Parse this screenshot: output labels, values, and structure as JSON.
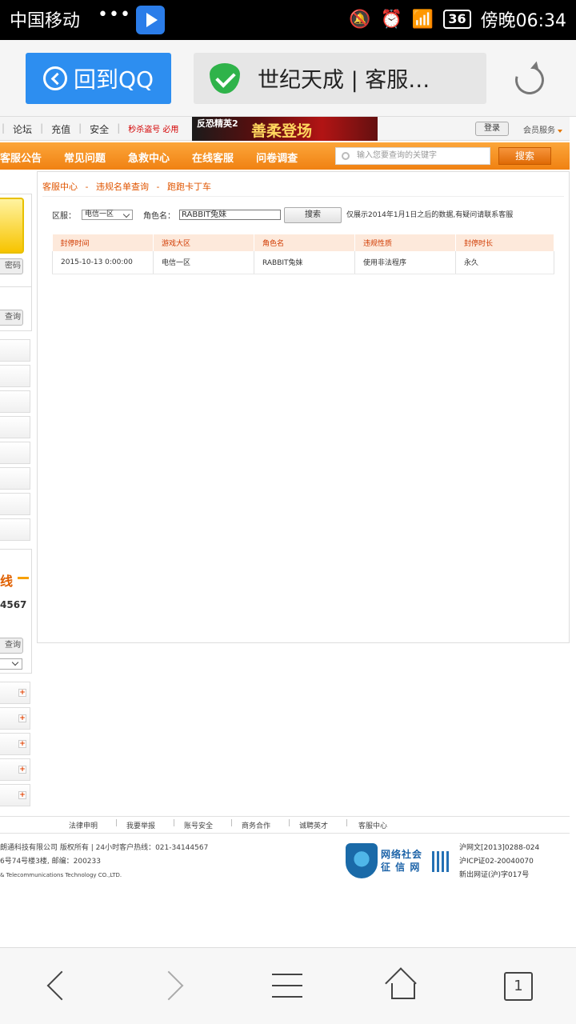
{
  "status_bar": {
    "carrier": "中国移动",
    "dots": "•••",
    "battery": "36",
    "time": "傍晚06:34"
  },
  "browser": {
    "back_label": "回到QQ",
    "page_title": "世纪天成 | 客服…"
  },
  "top_nav": {
    "links": [
      "论坛",
      "充值",
      "安全"
    ],
    "promo": "秒杀盗号 必用",
    "banner_game": "反恐精英2",
    "banner_slogan": "善柔登场",
    "login": "登录",
    "member": "会员服务"
  },
  "main_nav": {
    "items": [
      "客服公告",
      "常见问题",
      "急救中心",
      "在线客服",
      "问卷调查"
    ],
    "search_placeholder": "输入您要查询的关键字",
    "search_button": "搜索"
  },
  "sidebar": {
    "btn_password": "密码",
    "btn_query1": "查询",
    "promo_char": "线",
    "phone_part": "4567",
    "btn_query2": "查询"
  },
  "content": {
    "breadcrumb": [
      "客服中心",
      "违规名单查询",
      "跑跑卡丁车"
    ],
    "breadcrumb_sep": "-",
    "region_label": "区服：",
    "region_value": "电信一区",
    "name_label": "角色名：",
    "name_value": "RABBIT兔妹",
    "query_button": "搜索",
    "note": "仅展示2014年1月1日之后的数据,有疑问请联系客服",
    "table": {
      "headers": [
        "封停时间",
        "游戏大区",
        "角色名",
        "违规性质",
        "封停时长"
      ],
      "rows": [
        [
          "2015-10-13 0:00:00",
          "电信一区",
          "RABBIT兔妹",
          "使用非法程序",
          "永久"
        ]
      ]
    }
  },
  "footer": {
    "links": [
      "法律申明",
      "我要举报",
      "账号安全",
      "商务合作",
      "诚聘英才",
      "客服中心"
    ],
    "copyright1": "朗通科技有限公司 版权所有 | 24小时客户热线：021-34144567",
    "copyright2": "6号74号楼3楼, 邮编：200233",
    "copyright3": "& Telecommunications Technology CO.,LTD.",
    "credit_line1": "网络社会",
    "credit_line2": "征 信 网",
    "icp1": "沪网文[2013]0288-024",
    "icp2": "沪ICP证02-20040070",
    "icp3": "新出网证(沪)字017号"
  },
  "bottom_bar": {
    "tabs_count": "1"
  }
}
